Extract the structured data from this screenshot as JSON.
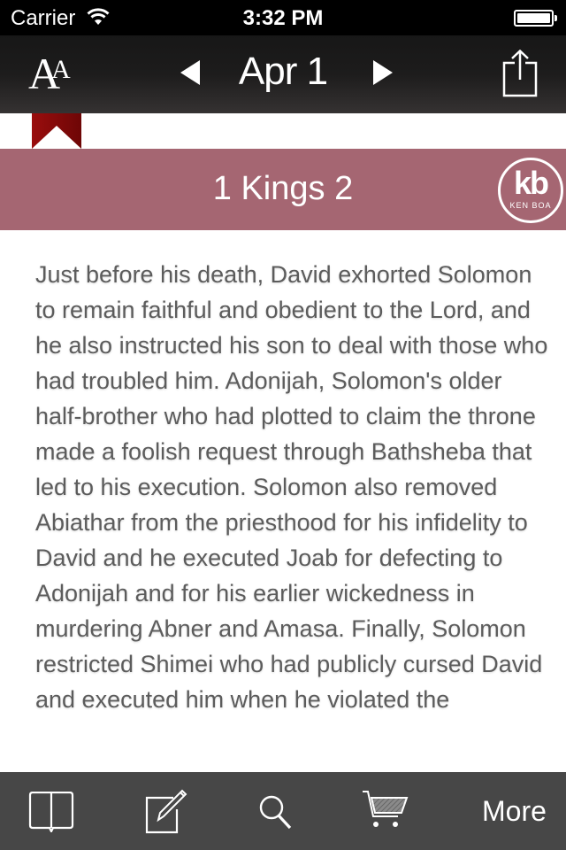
{
  "status_bar": {
    "carrier": "Carrier",
    "time": "3:32 PM",
    "wifi_icon": "wifi-icon",
    "battery_icon": "battery-full-icon"
  },
  "nav_bar": {
    "font_size_icon": "font-size-icon",
    "font_size_big": "A",
    "font_size_small": "A",
    "prev_icon": "triangle-left-icon",
    "date": "Apr 1",
    "next_icon": "triangle-right-icon",
    "share_icon": "share-icon"
  },
  "bookmark": {
    "icon": "bookmark-ribbon-icon",
    "color": "#8f0a0a"
  },
  "heading": {
    "title": "1 Kings 2",
    "background_color": "#a56672",
    "logo_mark": "kb",
    "logo_name": "KEN BOA"
  },
  "content": {
    "summary": "Just before his death, David exhorted Solomon to remain faithful and obedient to the Lord, and he also instructed his son to deal with those who had troubled him. Adonijah, Solomon's older half-brother who had plotted to claim the throne made a foolish request through Bathsheba that led to his execution. Solomon also removed Abiathar from the priesthood for his infidelity to David and he executed Joab for defecting to Adonijah and for his earlier wickedness in murdering Abner and Amasa. Finally, Solomon restricted Shimei who had publicly cursed David and executed him when he violated the"
  },
  "tab_bar": {
    "items": [
      {
        "icon": "open-book-icon"
      },
      {
        "icon": "compose-icon"
      },
      {
        "icon": "search-icon"
      },
      {
        "icon": "shopping-cart-icon"
      },
      {
        "label": "More"
      }
    ]
  }
}
